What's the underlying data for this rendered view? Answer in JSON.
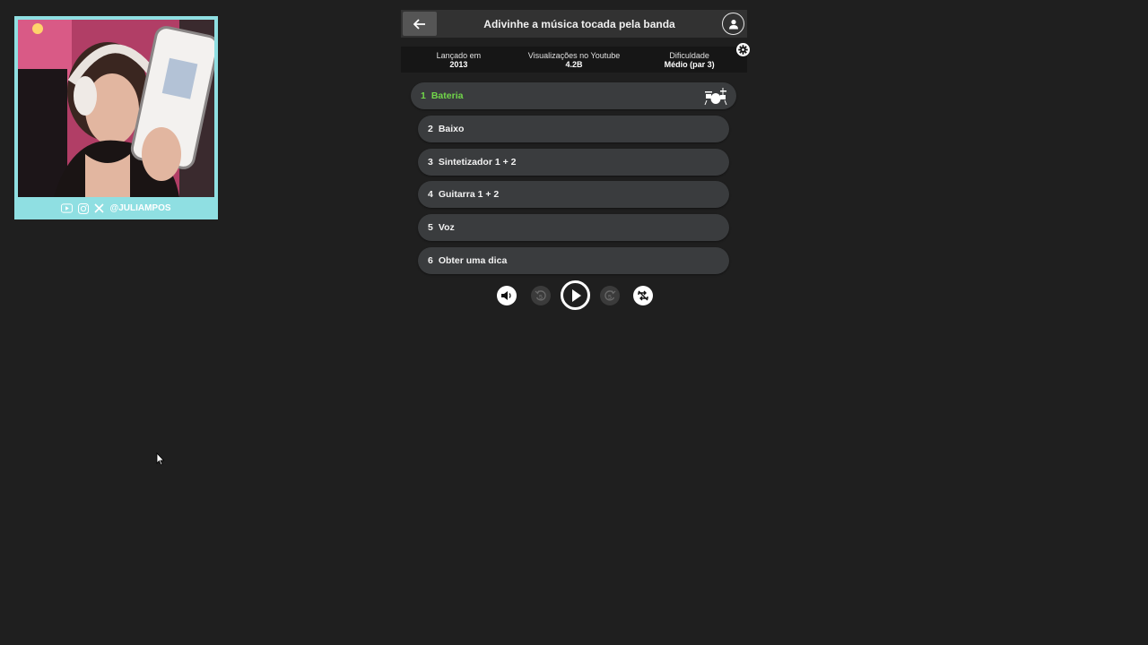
{
  "webcam": {
    "handle": "@JULIAMPOS",
    "social_icons": [
      "youtube-icon",
      "instagram-icon",
      "x-icon"
    ]
  },
  "header": {
    "title": "Adivinhe a música tocada pela banda",
    "back_icon": "arrow-left-icon",
    "profile_icon": "user-icon"
  },
  "stats": [
    {
      "label": "Lançado em",
      "value": "2013"
    },
    {
      "label": "Visualizações no Youtube",
      "value": "4.2B"
    },
    {
      "label": "Dificuldade",
      "value": "Médio (par 3)"
    }
  ],
  "tracks": [
    {
      "number": "1",
      "label": "Bateria",
      "active": true,
      "icon": "drum-kit-icon"
    },
    {
      "number": "2",
      "label": "Baixo"
    },
    {
      "number": "3",
      "label": "Sintetizador 1 + 2"
    },
    {
      "number": "4",
      "label": "Guitarra 1 + 2"
    },
    {
      "number": "5",
      "label": "Voz"
    },
    {
      "number": "6",
      "label": "Obter uma dica"
    }
  ],
  "controls": {
    "volume_icon": "speaker-icon",
    "rewind_label": "5",
    "play_icon": "play-icon",
    "forward_label": "5",
    "loop_icon": "repeat-off-icon"
  },
  "colors": {
    "background": "#1f1f1f",
    "accent_active": "#71d64a",
    "webcam_frame": "#8fdfe2"
  }
}
